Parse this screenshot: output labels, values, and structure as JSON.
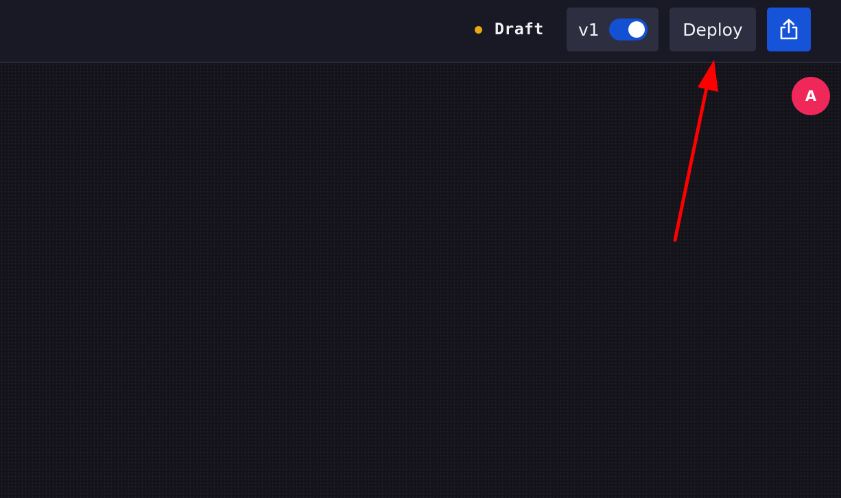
{
  "header": {
    "status": {
      "label": "Draft",
      "dot_color": "#e8a912"
    },
    "version": {
      "label": "v1",
      "toggle_on": true,
      "toggle_color": "#1450d4"
    },
    "deploy_button": {
      "label": "Deploy"
    },
    "share_button": {
      "icon": "share-upload-icon",
      "color": "#1553d8"
    }
  },
  "avatar": {
    "initial": "A",
    "color": "#f0285a"
  },
  "annotation": {
    "type": "arrow",
    "color": "#ff0000",
    "points_to": "deploy-button"
  }
}
